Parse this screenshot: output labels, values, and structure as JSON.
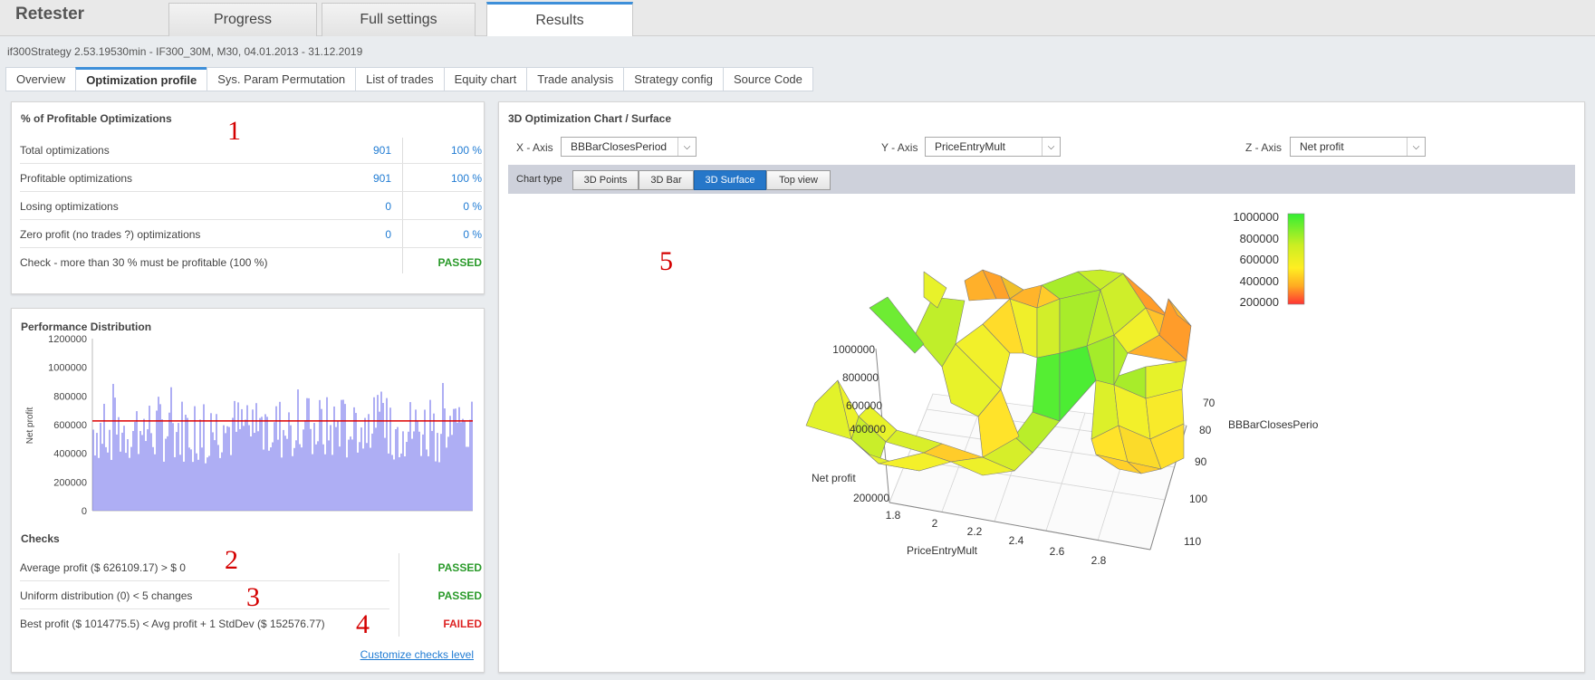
{
  "app": {
    "title": "Retester"
  },
  "main_tabs": [
    {
      "label": "Progress"
    },
    {
      "label": "Full settings"
    },
    {
      "label": "Results"
    }
  ],
  "subtitle": "if300Strategy 2.53.19530min - IF300_30M, M30, 04.01.2013 - 31.12.2019",
  "sub_tabs": [
    {
      "label": "Overview"
    },
    {
      "label": "Optimization profile"
    },
    {
      "label": "Sys. Param Permutation"
    },
    {
      "label": "List of trades"
    },
    {
      "label": "Equity chart"
    },
    {
      "label": "Trade analysis"
    },
    {
      "label": "Strategy config"
    },
    {
      "label": "Source Code"
    }
  ],
  "profitable": {
    "title": "% of Profitable Optimizations",
    "rows": [
      {
        "label": "Total optimizations",
        "count": "901",
        "pct": "100 %"
      },
      {
        "label": "Profitable optimizations",
        "count": "901",
        "pct": "100 %"
      },
      {
        "label": "Losing optimizations",
        "count": "0",
        "pct": "0 %"
      },
      {
        "label": "Zero profit (no trades ?) optimizations",
        "count": "0",
        "pct": "0 %"
      }
    ],
    "check": {
      "label": "Check - more than 30 % must be profitable (100 %)",
      "status": "PASSED"
    }
  },
  "performance": {
    "title": "Performance Distribution",
    "ylabel": "Net profit",
    "yticks": [
      "0",
      "200000",
      "400000",
      "600000",
      "800000",
      "1000000",
      "1200000"
    ],
    "average": 626109.17
  },
  "checks": {
    "title": "Checks",
    "rows": [
      {
        "label": "Average profit ($ 626109.17) > $ 0",
        "status": "PASSED"
      },
      {
        "label": "Uniform distribution (0) < 5 changes",
        "status": "PASSED"
      },
      {
        "label": "Best profit ($ 1014775.5) < Avg profit + 1 StdDev ($ 152576.77)",
        "status": "FAILED"
      }
    ],
    "customize_link": "Customize checks level"
  },
  "markers": [
    "1",
    "2",
    "3",
    "4",
    "5"
  ],
  "chart3d": {
    "title": "3D Optimization Chart / Surface",
    "x_axis": {
      "label": "X - Axis",
      "value": "BBBarClosesPeriod"
    },
    "y_axis": {
      "label": "Y - Axis",
      "value": "PriceEntryMult"
    },
    "z_axis": {
      "label": "Z - Axis",
      "value": "Net profit"
    },
    "chart_type_label": "Chart type",
    "chart_types": [
      {
        "label": "3D Points"
      },
      {
        "label": "3D Bar"
      },
      {
        "label": "3D Surface"
      },
      {
        "label": "Top view"
      }
    ],
    "legend_ticks": [
      "1000000",
      "800000",
      "600000",
      "400000",
      "200000"
    ],
    "z_label": "Net profit",
    "z_ticks": [
      "1000000",
      "800000",
      "600000",
      "400000",
      "200000"
    ],
    "y_label": "PriceEntryMult",
    "y_ticks": [
      "1.8",
      "2",
      "2.2",
      "2.4",
      "2.6",
      "2.8"
    ],
    "x_label": "BBBarClosesPerio",
    "x_ticks": [
      "70",
      "80",
      "90",
      "100",
      "110"
    ]
  },
  "colors": {
    "accent": "#2677c9",
    "link": "#1f7bd3",
    "passed": "#2a9a2a",
    "failed": "#dd2222",
    "histogram": "#8c8cf0",
    "average_line": "#dd0000",
    "marker": "#d40000"
  }
}
